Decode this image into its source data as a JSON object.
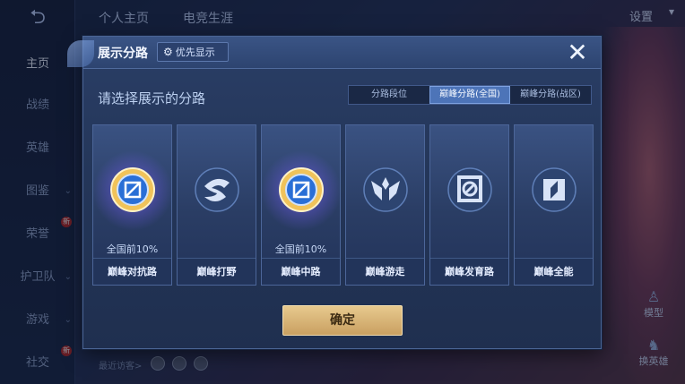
{
  "background": {
    "back_icon": "back-arrow-icon",
    "nav": [
      {
        "label": "主页",
        "active": true
      },
      {
        "label": "战绩"
      },
      {
        "label": "英雄"
      },
      {
        "label": "图鉴",
        "chevron": true
      },
      {
        "label": "荣誉",
        "badge": "新"
      },
      {
        "label": "护卫队",
        "chevron": true
      },
      {
        "label": "游戏",
        "chevron": true
      },
      {
        "label": "社交",
        "badge": "新",
        "chevron": true
      }
    ],
    "top_tabs": [
      "个人主页",
      "电竞生涯"
    ],
    "settings_label": "设置",
    "right_buttons": [
      {
        "label": "模型",
        "icon": "person-icon"
      },
      {
        "label": "换英雄",
        "icon": "swap-hero-icon"
      }
    ],
    "recent_visitors_label": "最近访客>"
  },
  "dialog": {
    "title": "展示分路",
    "priority_label": "优先显示",
    "close_symbol": "✕",
    "prompt": "请选择展示的分路",
    "segments": [
      {
        "label": "分路段位",
        "active": false
      },
      {
        "label": "巅峰分路(全国)",
        "active": true
      },
      {
        "label": "巅峰分路(战区)",
        "active": false
      }
    ],
    "cards": [
      {
        "name": "巅峰对抗路",
        "rank": "全国前10%",
        "highlighted": true,
        "icon": "top-lane-emblem-icon"
      },
      {
        "name": "巅峰打野",
        "rank": "",
        "highlighted": false,
        "icon": "jungle-dragon-icon"
      },
      {
        "name": "巅峰中路",
        "rank": "全国前10%",
        "highlighted": true,
        "icon": "mid-lane-emblem-icon"
      },
      {
        "name": "巅峰游走",
        "rank": "",
        "highlighted": false,
        "icon": "roam-wings-icon"
      },
      {
        "name": "巅峰发育路",
        "rank": "",
        "highlighted": false,
        "icon": "farm-lane-icon"
      },
      {
        "name": "巅峰全能",
        "rank": "",
        "highlighted": false,
        "icon": "all-round-icon"
      }
    ],
    "confirm_label": "确定"
  }
}
